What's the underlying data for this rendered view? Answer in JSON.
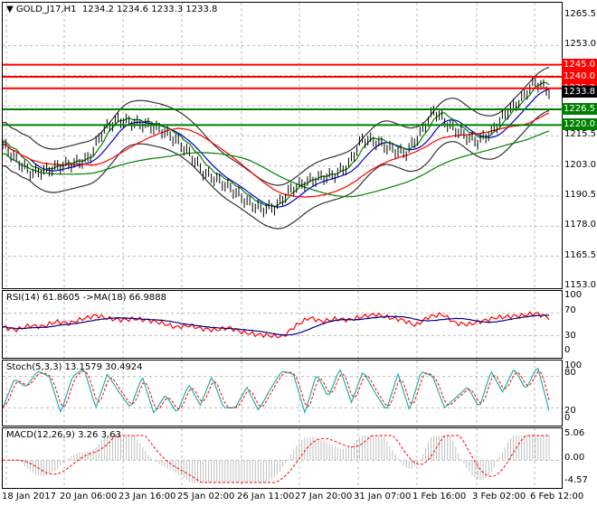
{
  "header": {
    "symbol": "GOLD_J17,H1",
    "ohlc": "1234.2 1234.6 1233.3 1233.8"
  },
  "colors": {
    "resistance": "#ff0000",
    "support": "#008000",
    "price": "#000000",
    "ma_fast": "#0000cc",
    "ma_mid": "#008000",
    "ma_slow": "#ff0000",
    "bands": "#333333"
  },
  "price_axis": {
    "ticks": [
      "1265.5",
      "1253.0",
      "1215.5",
      "1203.0",
      "1190.5",
      "1178.0",
      "1165.5",
      "1153.0"
    ],
    "range": [
      1153.0,
      1265.5
    ],
    "tags": [
      {
        "value": "1245.0",
        "color": "#ff0000"
      },
      {
        "value": "1240.0",
        "color": "#ff0000"
      },
      {
        "value": "1235.2",
        "color": "#ff0000"
      },
      {
        "value": "1233.8",
        "color": "#000000"
      },
      {
        "value": "1226.5",
        "color": "#008000"
      },
      {
        "value": "1220.0",
        "color": "#008000"
      }
    ]
  },
  "rsi": {
    "label": "RSI(14) 61.8605  ->MA(18) 66.9888",
    "ticks": [
      "100",
      "70",
      "30",
      "0"
    ]
  },
  "stoch": {
    "label": "Stoch(5,3,3) 13.1579 30.4924",
    "ticks": [
      "100",
      "80",
      "20",
      "0"
    ]
  },
  "macd": {
    "label": "MACD(12,26,9) 3.26 3.63",
    "ticks": [
      "5.06",
      "0.00",
      "-4.57"
    ]
  },
  "dates": [
    "18 Jan 2017",
    "20 Jan 06:00",
    "23 Jan 16:00",
    "25 Jan 02:00",
    "26 Jan 11:00",
    "27 Jan 20:00",
    "31 Jan 07:00",
    "1 Feb 16:00",
    "3 Feb 02:00",
    "6 Feb 12:00"
  ],
  "chart_data": {
    "type": "line",
    "price_close": [
      1212,
      1205,
      1200,
      1201,
      1203,
      1204,
      1206,
      1218,
      1222,
      1221,
      1220,
      1218,
      1214,
      1208,
      1200,
      1197,
      1193,
      1188,
      1185,
      1186,
      1193,
      1196,
      1198,
      1199,
      1203,
      1214,
      1213,
      1210,
      1208,
      1216,
      1226,
      1220,
      1216,
      1213,
      1217,
      1225,
      1230,
      1238,
      1234
    ],
    "rsi": [
      45,
      40,
      48,
      46,
      55,
      52,
      60,
      66,
      60,
      58,
      60,
      57,
      52,
      45,
      48,
      42,
      40,
      44,
      36,
      32,
      30,
      28,
      48,
      62,
      55,
      60,
      58,
      64,
      68,
      62,
      58,
      48,
      64,
      68,
      52,
      50,
      56,
      62,
      64,
      66,
      70,
      62
    ],
    "stoch": [
      20,
      75,
      60,
      90,
      80,
      10,
      80,
      95,
      20,
      85,
      50,
      20,
      80,
      10,
      45,
      10,
      65,
      25,
      80,
      20,
      20,
      60,
      15,
      55,
      90,
      85,
      10,
      85,
      40,
      95,
      30,
      90,
      50,
      15,
      85,
      15,
      90,
      80,
      20,
      40,
      60,
      20,
      90,
      50,
      95,
      55,
      100,
      15
    ]
  }
}
